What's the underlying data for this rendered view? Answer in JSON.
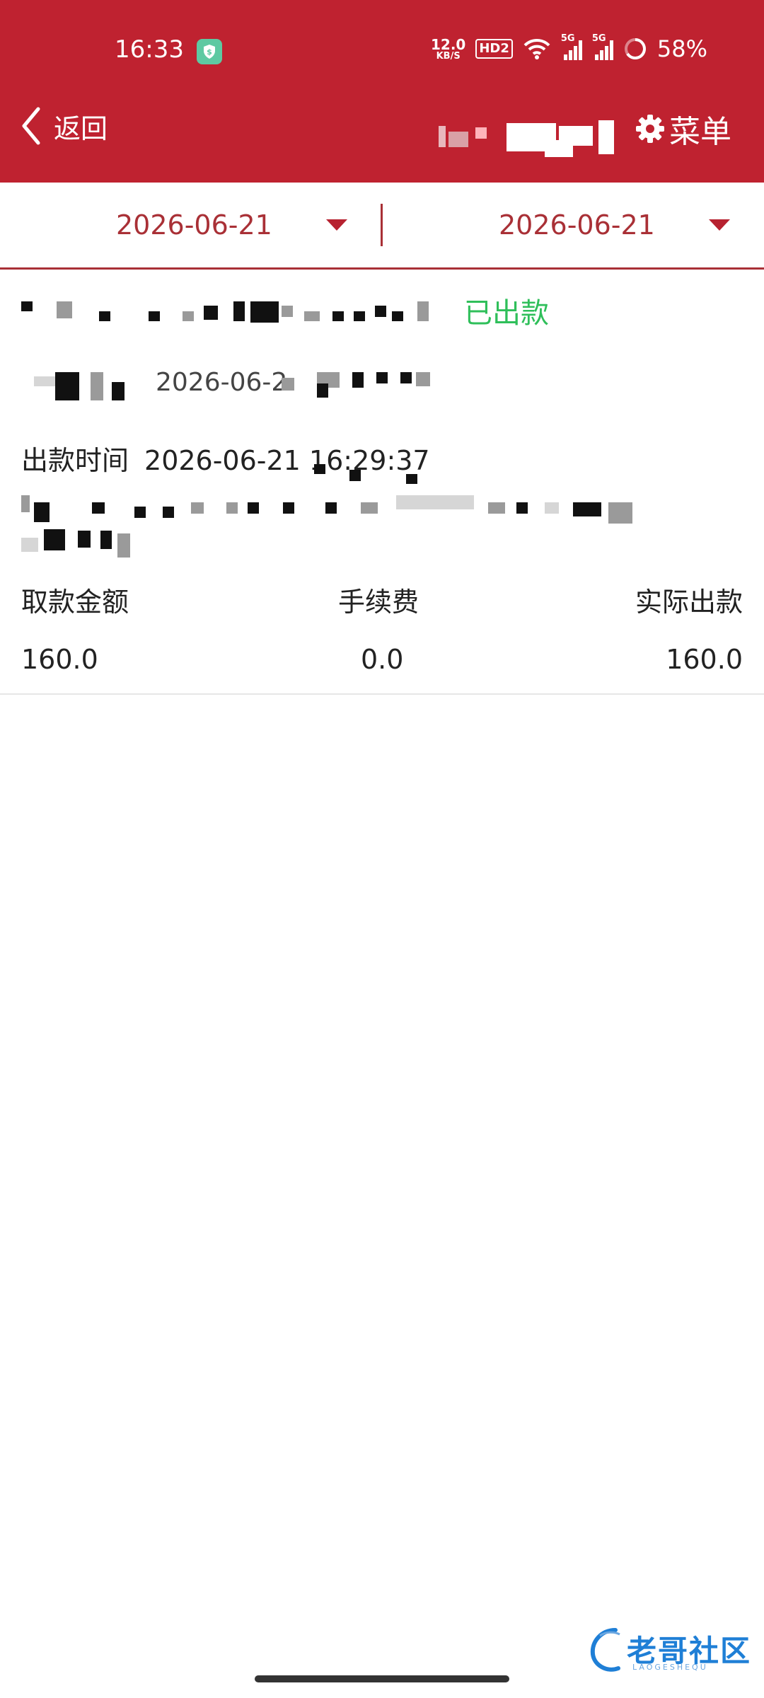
{
  "status_bar": {
    "time": "16:33",
    "net_speed_value": "12.0",
    "net_speed_unit": "KB/S",
    "hd_label": "HD2",
    "signal1_label": "5G",
    "signal2_label": "5G",
    "battery": "58%"
  },
  "header": {
    "back_label": "返回",
    "menu_label": "菜单"
  },
  "date_filter": {
    "start_date": "2026-06-21",
    "end_date": "2026-06-21"
  },
  "record": {
    "status": "已出款",
    "partial_date": "2026-06-2",
    "payout_time_label": "出款时间",
    "payout_time_value": "2026-06-21 16:29:37",
    "columns": [
      "取款金额",
      "手续费",
      "实际出款"
    ],
    "values": [
      "160.0",
      "0.0",
      "160.0"
    ]
  },
  "watermark": {
    "text": "老哥社区",
    "sub": "LAOGESHEQU"
  },
  "colors": {
    "header_bg": "#bf2230",
    "accent": "#a93036",
    "status_green": "#2fbf5a"
  }
}
